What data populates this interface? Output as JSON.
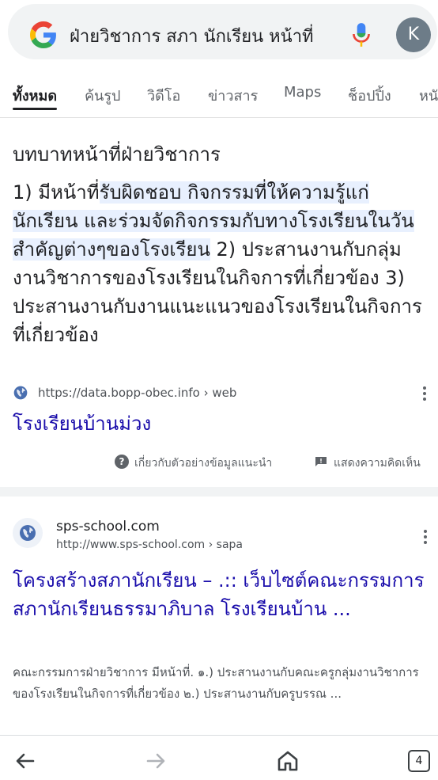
{
  "search": {
    "query": "ฝ่ายวิชาการ สภา นักเรียน หน้าที่",
    "avatar_letter": "K"
  },
  "tabs": [
    {
      "label": "ทั้งหมด",
      "active": true
    },
    {
      "label": "ค้นรูป"
    },
    {
      "label": "วิดีโอ"
    },
    {
      "label": "ข่าวสาร"
    },
    {
      "label": "Maps"
    },
    {
      "label": "ช็อปปิ้ง"
    },
    {
      "label": "หนั"
    }
  ],
  "snippet": {
    "heading": "บทบาทหน้าที่ฝ่ายวิชาการ",
    "text_pre": "1) มีหน้าที่",
    "text_highlight": "รับผิดชอบ กิจกรรมที่ให้ความรู้แก่นักเรียน และร่วมจัดกิจกรรมกับทางโรงเรียนในวันสำคัญต่างๆของโรงเรียน",
    "text_post": " 2) ประสานงานกับกลุ่มงานวิชาการของโรงเรียนในกิจการที่เกี่ยวข้อง 3) ประสานงานกับงานแนะแนวของโรงเรียนในกิจการที่เกี่ยวข้อง",
    "source_url": "https://data.bopp-obec.info › web",
    "link_title": "โรงเรียนบ้านม่วง",
    "about_label": "เกี่ยวกับตัวอย่างข้อมูลแนะนำ",
    "feedback_label": "แสดงความคิดเห็น"
  },
  "result": {
    "site_name": "sps-school.com",
    "url": "http://www.sps-school.com › sapa",
    "title": "โครงสร้างสภานักเรียน – .:: เว็บไซต์คณะกรรมการสภานักเรียนธรรมาภิบาล โรงเรียนบ้าน ...",
    "description": "คณะกรรมการฝ่ายวิชาการ มีหน้าที่. ๑.) ประสานงานกับคณะครูกลุ่มงานวิชาการของโรงเรียนในกิจการที่เกี่ยวข้อง ๒.) ประสานงานกับครูบรรณ ..."
  },
  "bottom_nav": {
    "tab_count": "4"
  },
  "colors": {
    "link": "#1a0dab",
    "highlight": "#e8f0fe",
    "search_bg": "#f1f3f4",
    "avatar": "#6d7c88"
  },
  "icons": [
    "google-logo-icon",
    "mic-icon",
    "globe-icon",
    "more-vert-icon",
    "help-icon",
    "feedback-icon",
    "back-icon",
    "forward-icon",
    "home-icon",
    "tabs-icon"
  ]
}
